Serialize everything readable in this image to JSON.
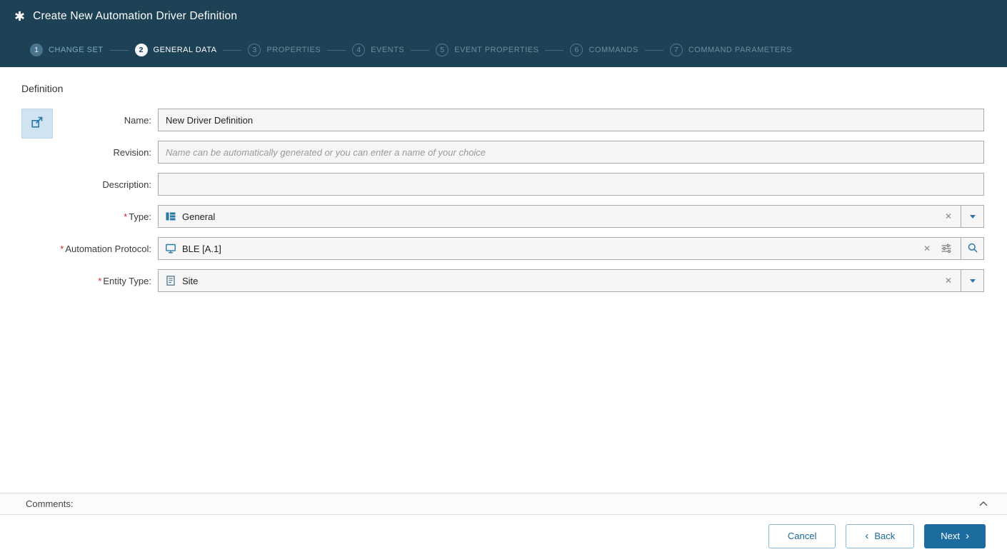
{
  "header": {
    "title": "Create New Automation Driver Definition"
  },
  "wizard": {
    "steps": [
      {
        "number": "1",
        "label": "CHANGE SET",
        "state": "completed"
      },
      {
        "number": "2",
        "label": "GENERAL DATA",
        "state": "active"
      },
      {
        "number": "3",
        "label": "PROPERTIES",
        "state": "upcoming"
      },
      {
        "number": "4",
        "label": "EVENTS",
        "state": "upcoming"
      },
      {
        "number": "5",
        "label": "EVENT PROPERTIES",
        "state": "upcoming"
      },
      {
        "number": "6",
        "label": "COMMANDS",
        "state": "upcoming"
      },
      {
        "number": "7",
        "label": "COMMAND PARAMETERS",
        "state": "upcoming"
      }
    ]
  },
  "form": {
    "section_title": "Definition",
    "required_marker": "*",
    "fields": {
      "name": {
        "label": "Name:",
        "value": "New Driver Definition"
      },
      "revision": {
        "label": "Revision:",
        "value": "",
        "placeholder": "Name can be automatically generated or you can enter a name of your choice"
      },
      "description": {
        "label": "Description:",
        "value": ""
      },
      "type": {
        "label": "Type:",
        "value": "General",
        "required": true
      },
      "automation_protocol": {
        "label": "Automation Protocol:",
        "value": "BLE [A.1]",
        "required": true
      },
      "entity_type": {
        "label": "Entity Type:",
        "value": "Site",
        "required": true
      }
    }
  },
  "comments": {
    "label": "Comments:"
  },
  "footer": {
    "cancel_label": "Cancel",
    "back_label": "Back",
    "next_label": "Next"
  },
  "icons": {
    "app_glyph": "✱",
    "clear_glyph": "✕",
    "back_chevron": "‹",
    "next_chevron": "›"
  },
  "colors": {
    "header_bg": "#1d4155",
    "accent_blue": "#2b77a5",
    "primary_button_bg": "#1c6ca0",
    "required_red": "#c62828",
    "field_bg": "#f6f6f6",
    "field_border": "#aaaaaa",
    "expand_button_bg": "#cfe3f0"
  }
}
